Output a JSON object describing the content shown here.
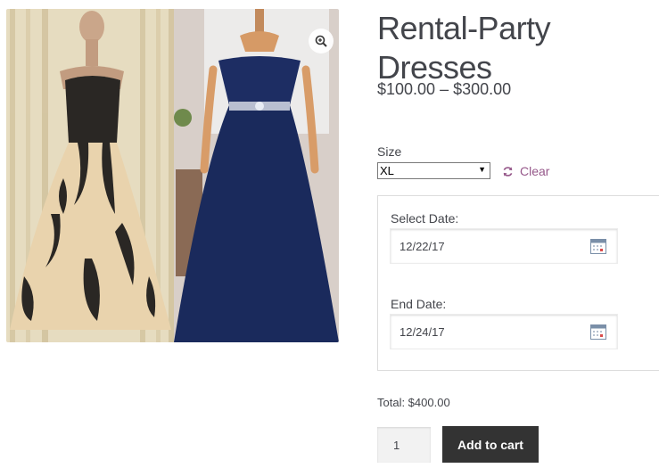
{
  "product": {
    "title": "Rental-Party Dresses",
    "price_range": "$100.00 – $300.00",
    "image_alt": "Two party dresses on mannequins"
  },
  "icons": {
    "zoom": "magnifier-plus-icon",
    "clear": "refresh-icon",
    "calendar": "calendar-icon"
  },
  "variation": {
    "size_label": "Size",
    "size_value": "XL",
    "clear_label": "Clear"
  },
  "booking": {
    "start_label": "Select Date:",
    "start_value": "12/22/17",
    "end_label": "End Date:",
    "end_value": "12/24/17"
  },
  "total": "Total: $400.00",
  "cart": {
    "quantity": "1",
    "button_label": "Add to cart"
  },
  "colors": {
    "accent": "#96588a",
    "button_bg": "#333333",
    "text": "#43454b"
  }
}
